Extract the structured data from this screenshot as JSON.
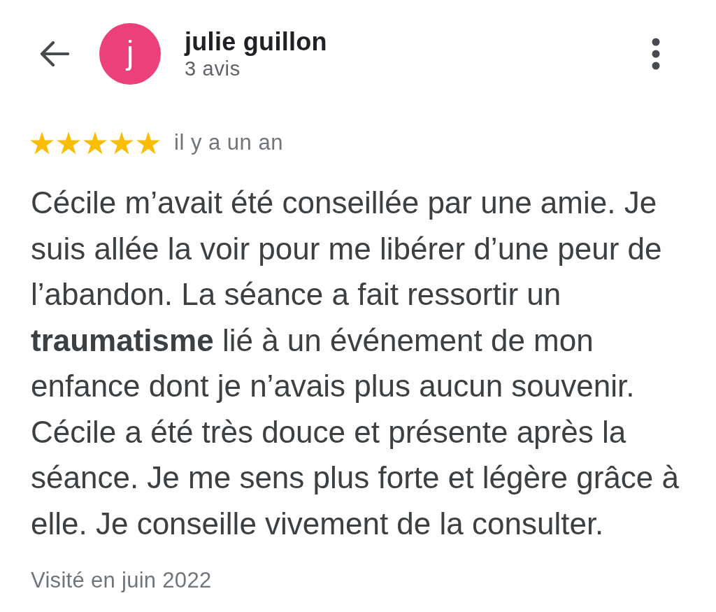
{
  "reviewer": {
    "initial": "j",
    "name": "julie guillon",
    "review_count": "3 avis"
  },
  "review": {
    "stars": 5,
    "time": "il y a un an",
    "text": "Cécile m’avait été conseillée par une amie. Je suis allée la voir pour me libérer d’une peur de l’abandon. La séance a fait ressortir un **traumatisme** lié à un événement de mon enfance dont je n’avais plus aucun souvenir. Cécile a été très douce et présente après la séance. Je me sens plus forte et légère grâce à elle. Je conseille vivement de la consulter.",
    "visited": "Visité en juin 2022"
  }
}
